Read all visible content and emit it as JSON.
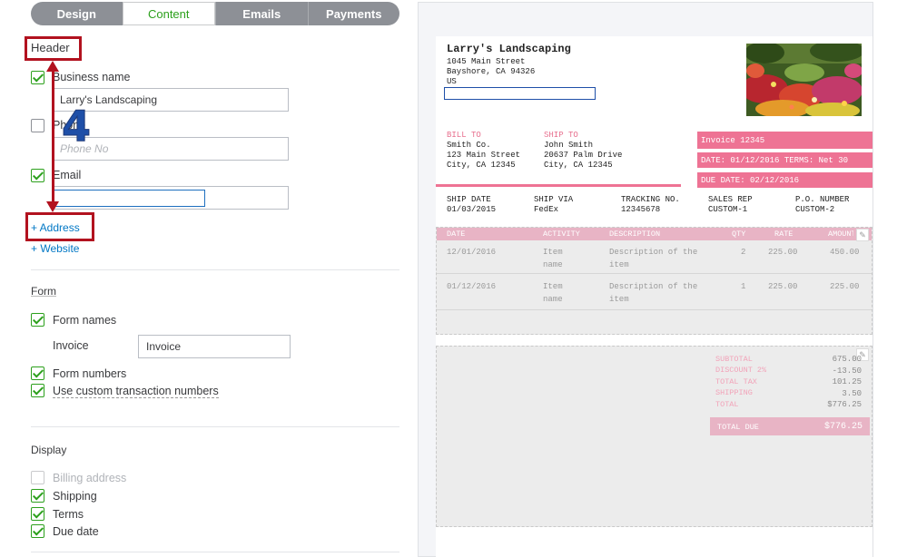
{
  "tabs": [
    {
      "label": "Design"
    },
    {
      "label": "Content"
    },
    {
      "label": "Emails"
    },
    {
      "label": "Payments"
    }
  ],
  "header": {
    "title": "Header",
    "business_name_label": "Business name",
    "business_name_value": "Larry's Landscaping",
    "phone_label": "Phone",
    "phone_placeholder": "Phone No",
    "email_label": "Email",
    "email_value": "",
    "add_address": "+ Address",
    "add_website": "+ Website"
  },
  "annotation": {
    "step_number": "4"
  },
  "form": {
    "title": "Form",
    "form_names_label": "Form names",
    "invoice_label": "Invoice",
    "invoice_value": "Invoice",
    "form_numbers_label": "Form numbers",
    "custom_txn_label": "Use custom transaction numbers"
  },
  "display": {
    "title": "Display",
    "billing_address": "Billing address",
    "shipping": "Shipping",
    "terms": "Terms",
    "due_date": "Due date"
  },
  "invoice": {
    "company_name": "Larry's Landscaping",
    "company_address": [
      "1045 Main Street",
      "Bayshore, CA 94326",
      "US"
    ],
    "bill_to_label": "BILL TO",
    "bill_to": [
      "Smith Co.",
      "123 Main Street",
      "City, CA 12345"
    ],
    "ship_to_label": "SHIP TO",
    "ship_to": [
      "John Smith",
      "20637 Palm Drive",
      "City, CA 12345"
    ],
    "invoice_number": "Invoice 12345",
    "date_terms": "DATE: 01/12/2016 TERMS: Net 30",
    "due_date": "DUE DATE: 02/12/2016",
    "ship_headers": [
      "SHIP DATE",
      "SHIP VIA",
      "TRACKING NO.",
      "SALES REP",
      "P.O. NUMBER"
    ],
    "ship_values": [
      "01/03/2015",
      "FedEx",
      "12345678",
      "CUSTOM-1",
      "CUSTOM-2"
    ],
    "line_headers": [
      "DATE",
      "ACTIVITY",
      "DESCRIPTION",
      "QTY",
      "RATE",
      "AMOUNT"
    ],
    "lines": [
      {
        "date": "12/01/2016",
        "activity": [
          "Item",
          "name"
        ],
        "description": [
          "Description of the",
          "item"
        ],
        "qty": "2",
        "rate": "225.00",
        "amount": "450.00"
      },
      {
        "date": "01/12/2016",
        "activity": [
          "Item",
          "name"
        ],
        "description": [
          "Description of the",
          "item"
        ],
        "qty": "1",
        "rate": "225.00",
        "amount": "225.00"
      }
    ],
    "summary": [
      {
        "label": "SUBTOTAL",
        "value": "675.00"
      },
      {
        "label": "DISCOUNT 2%",
        "value": "-13.50"
      },
      {
        "label": "TOTAL TAX",
        "value": "101.25"
      },
      {
        "label": "SHIPPING",
        "value": "3.50"
      },
      {
        "label": "TOTAL",
        "value": "$776.25"
      }
    ],
    "total_due_label": "TOTAL DUE",
    "total_due_value": "$776.25"
  },
  "colors": {
    "accent_green": "#2ca01c",
    "invoice_pink": "#ee7394",
    "annotation_red": "#b2121f",
    "link_blue": "#0077c5"
  }
}
